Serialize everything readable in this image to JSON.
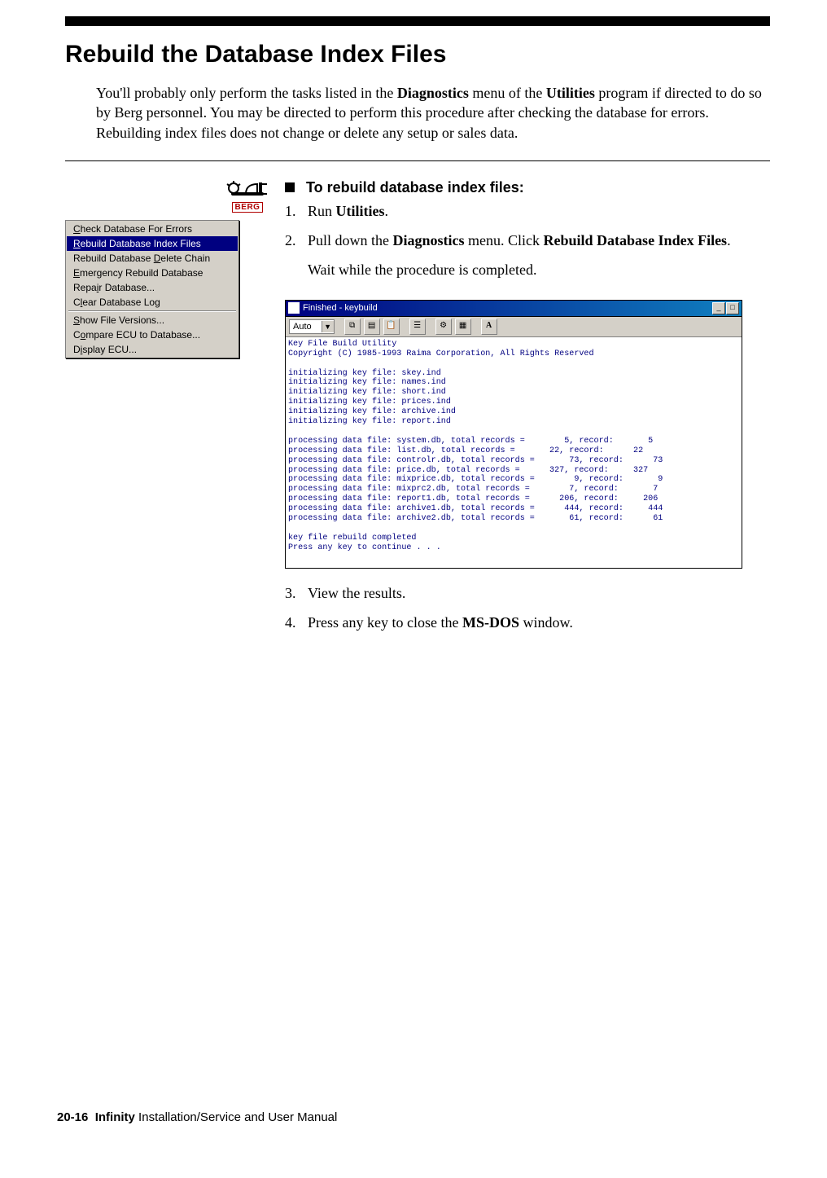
{
  "header": {
    "title": "Rebuild the Database Index Files"
  },
  "intro": {
    "text_before": "You'll probably only perform the tasks listed in the ",
    "bold1": "Diagnostics",
    "mid1": " menu of the ",
    "bold2": "Utilities",
    "text_after": " program if directed to do so by Berg personnel. You may be directed to perform this procedure after checking the database for errors. Rebuilding index files does not change or delete any setup or sales data."
  },
  "logo": {
    "brand": "BERG"
  },
  "menu": {
    "items": [
      {
        "underline": "C",
        "rest": "heck Database For Errors",
        "selected": false
      },
      {
        "underline": "R",
        "rest": "ebuild Database Index Files",
        "selected": true
      },
      {
        "pre": "Rebuild Database ",
        "underline": "D",
        "rest": "elete Chain",
        "selected": false
      },
      {
        "underline": "E",
        "rest": "mergency Rebuild Database",
        "selected": false
      },
      {
        "pre": "Repa",
        "underline": "i",
        "rest": "r Database...",
        "selected": false
      },
      {
        "pre": "C",
        "underline": "l",
        "rest": "ear Database Log",
        "selected": false
      }
    ],
    "items2": [
      {
        "underline": "S",
        "rest": "how File Versions...",
        "selected": false
      },
      {
        "pre": "C",
        "underline": "o",
        "rest": "mpare ECU to Database...",
        "selected": false
      },
      {
        "pre": "D",
        "underline": "i",
        "rest": "splay ECU...",
        "selected": false
      }
    ]
  },
  "task": {
    "heading": "To rebuild database index files:",
    "steps": {
      "s1": {
        "num": "1.",
        "pre": "Run ",
        "b1": "Utilities",
        "post": "."
      },
      "s2": {
        "num": "2.",
        "pre": "Pull down the ",
        "b1": "Diagnostics",
        "mid": " menu. Click ",
        "b2": "Rebuild Database Index Files",
        "post": ".",
        "sub": "Wait while the procedure is completed."
      },
      "s3": {
        "num": "3.",
        "txt": "View the results."
      },
      "s4": {
        "num": "4.",
        "pre": "Press any key to close the ",
        "b1": "MS-DOS",
        "post": " window."
      }
    }
  },
  "dos": {
    "title": "Finished - keybuild",
    "toolbar": {
      "combo": "Auto",
      "btn_a": "A"
    },
    "body": "Key File Build Utility\nCopyright (C) 1985-1993 Raima Corporation, All Rights Reserved\n\ninitializing key file: skey.ind\ninitializing key file: names.ind\ninitializing key file: short.ind\ninitializing key file: prices.ind\ninitializing key file: archive.ind\ninitializing key file: report.ind\n\nprocessing data file: system.db, total records =        5, record:       5\nprocessing data file: list.db, total records =       22, record:      22\nprocessing data file: controlr.db, total records =       73, record:      73\nprocessing data file: price.db, total records =      327, record:     327\nprocessing data file: mixprice.db, total records =        9, record:       9\nprocessing data file: mixprc2.db, total records =        7, record:       7\nprocessing data file: report1.db, total records =      206, record:     206\nprocessing data file: archive1.db, total records =      444, record:     444\nprocessing data file: archive2.db, total records =       61, record:      61\n\nkey file rebuild completed\nPress any key to continue . . ."
  },
  "footer": {
    "page": "20-16",
    "product": "Infinity",
    "rest": " Installation/Service and User Manual"
  }
}
